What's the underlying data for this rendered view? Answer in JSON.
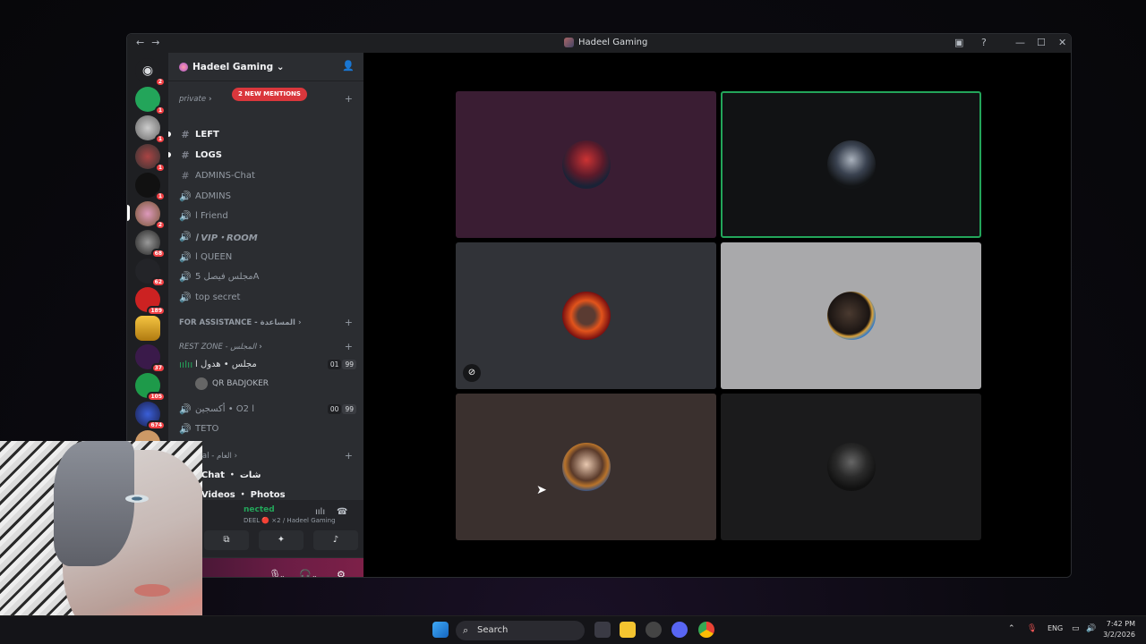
{
  "window": {
    "title": "Hadeel Gaming",
    "back": "←",
    "forward": "→",
    "controls": {
      "minimize": "—",
      "maximize": "☐",
      "close": "✕",
      "inbox": "▣",
      "help": "?"
    }
  },
  "guilds": {
    "badges": [
      "2",
      "1",
      "1",
      "1",
      "1",
      "2",
      "68",
      "62",
      "189",
      "",
      "37",
      "105",
      "674"
    ]
  },
  "server": {
    "name": "Hadeel Gaming",
    "chevron": "⌄",
    "invite_icon": "👤"
  },
  "mentions_pill": "2 NEW MENTIONS",
  "categories": {
    "private": "private",
    "for_assistance": "FOR ASSISTANCE - المساعدة",
    "rest_zone": "REST ZONE - المجلس",
    "general": "General - العام"
  },
  "channels": [
    {
      "name": "LEFT",
      "icon": "#"
    },
    {
      "name": "LOGS",
      "icon": "#"
    },
    {
      "name": "ADMINS-Chat",
      "icon": "#"
    },
    {
      "name": "ADMINS",
      "icon": "🔊"
    },
    {
      "name": "ا Friend",
      "icon": "🔊"
    },
    {
      "name": "ا VIP・ROOM",
      "icon": "🔊"
    },
    {
      "name": "ا QUEEN",
      "icon": "🔊"
    },
    {
      "name": "مجلس فيصل 5A",
      "icon": "🔊"
    },
    {
      "name": "top secret",
      "icon": "🔊"
    }
  ],
  "rest_channels": [
    {
      "name": "مجلس • هدول ا",
      "count": "01",
      "limit": "99"
    },
    {
      "name": "أكسجين • O2 ا",
      "count": "00",
      "limit": "99"
    },
    {
      "name": "TETO",
      "count": "",
      "limit": ""
    }
  ],
  "voice_user": "QR BADJOKER",
  "general_channels": [
    {
      "name": "ا Chat ・ شات"
    },
    {
      "name": "ا Videos ・ Photos"
    }
  ],
  "connection": {
    "status": "Voice Connected",
    "status_visible": "nected",
    "sub": "DEEL 🔴 ×2 / Hadeel Gaming"
  },
  "taskbar": {
    "search": "Search",
    "lang": "ENG",
    "time": "7:42 PM",
    "date": "3/2/2026"
  }
}
